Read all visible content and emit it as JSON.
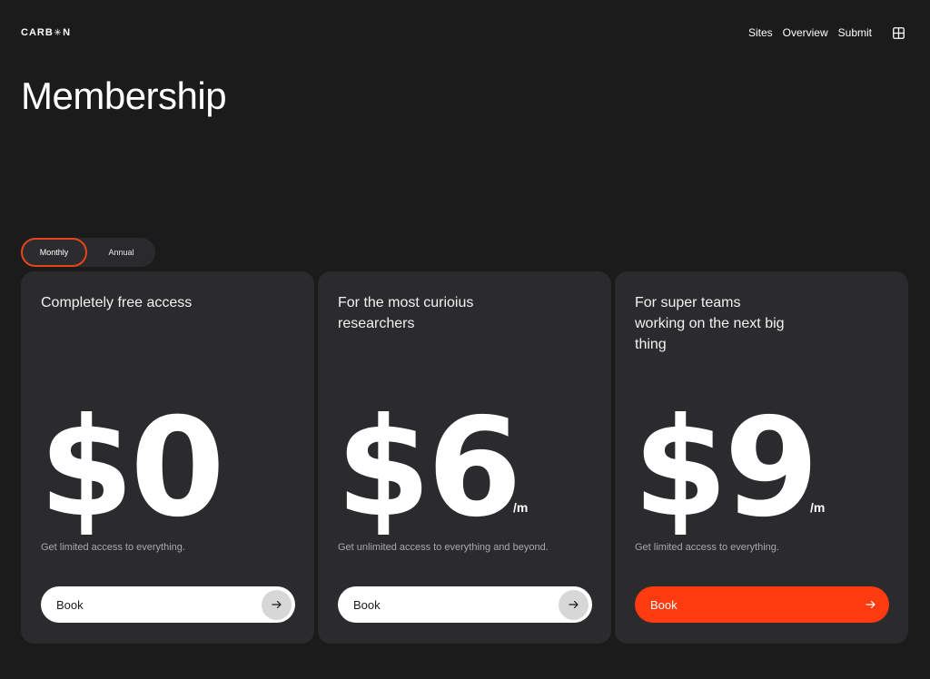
{
  "header": {
    "logo": {
      "part1": "CARB",
      "star": "✳",
      "part2": "N"
    },
    "nav": [
      "Sites",
      "Overview",
      "Submit"
    ],
    "menu_icon": "grid-icon"
  },
  "page": {
    "title": "Membership"
  },
  "billing_toggle": {
    "options": [
      "Monthly",
      "Annual"
    ],
    "selected": "Monthly"
  },
  "plans": [
    {
      "desc": "Completely free access",
      "price": "$0",
      "per": "",
      "note": "Get limited access to everything.",
      "cta": "Book",
      "highlight": false
    },
    {
      "desc": "For the most curioius researchers",
      "price": "$6",
      "per": "/m",
      "note": "Get unlimited access to everything and beyond.",
      "cta": "Book",
      "highlight": false
    },
    {
      "desc": "For super teams working on the next big thing",
      "price": "$9",
      "per": "/m",
      "note": "Get limited access to everything.",
      "cta": "Book",
      "highlight": true
    }
  ],
  "colors": {
    "background": "#1b1b1c",
    "card": "#2b2b2d",
    "accent": "#ff3b0f",
    "toggle_outline": "#e84419"
  }
}
